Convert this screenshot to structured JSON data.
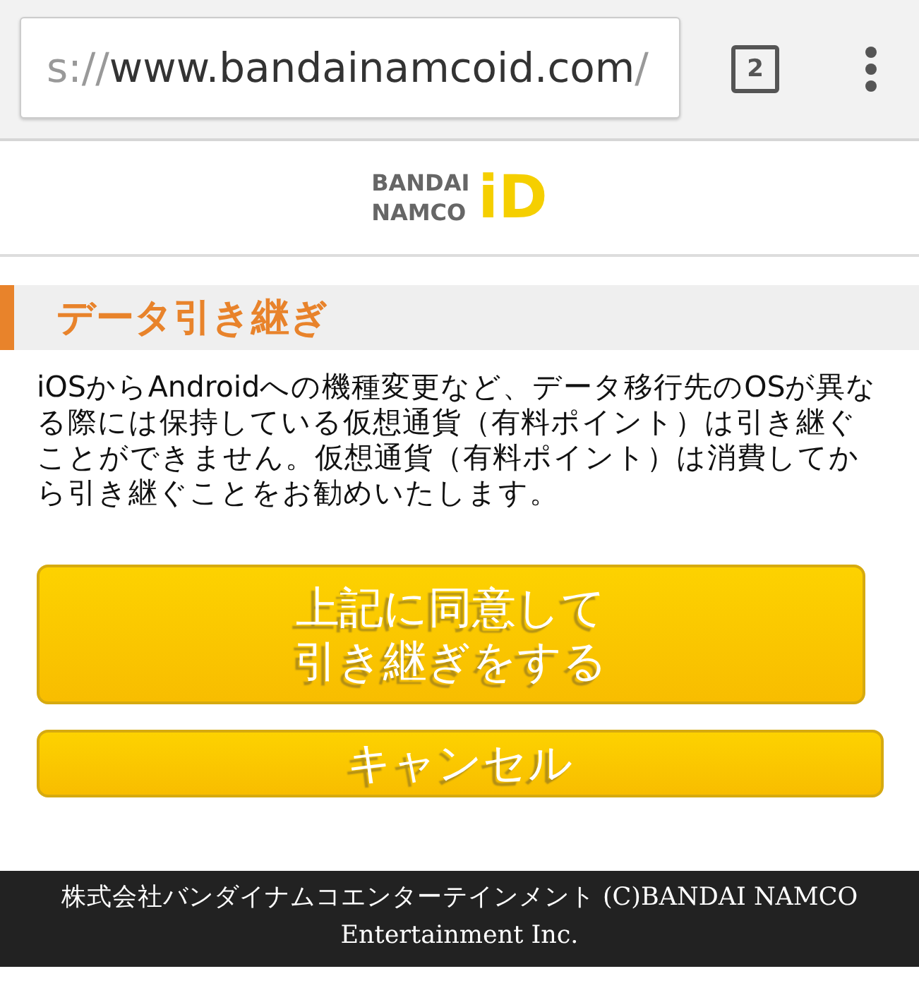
{
  "browser": {
    "url": {
      "scheme": "s://",
      "host": "www.bandainamcoid.com",
      "path": "/"
    },
    "tab_count": "2"
  },
  "logo": {
    "line_1": "BANDAI",
    "line_2": "NAMCO",
    "mark": "iD"
  },
  "heading": "データ引き継ぎ",
  "notice": "iOSからAndroidへの機種変更など、データ移行先のOSが異なる際には保持している仮想通貨（有料ポイント）は引き継ぐことができません。仮想通貨（有料ポイント）は消費してから引き継ぐことをお勧めいたします。",
  "buttons": [
    {
      "kind": "agree",
      "label": "上記に同意して引き継ぎをする"
    },
    {
      "kind": "cancel",
      "label": "キャンセル"
    }
  ],
  "footer": "株式会社バンダイナムコエンターテインメント (C)BANDAI NAMCO Entertainment Inc."
}
